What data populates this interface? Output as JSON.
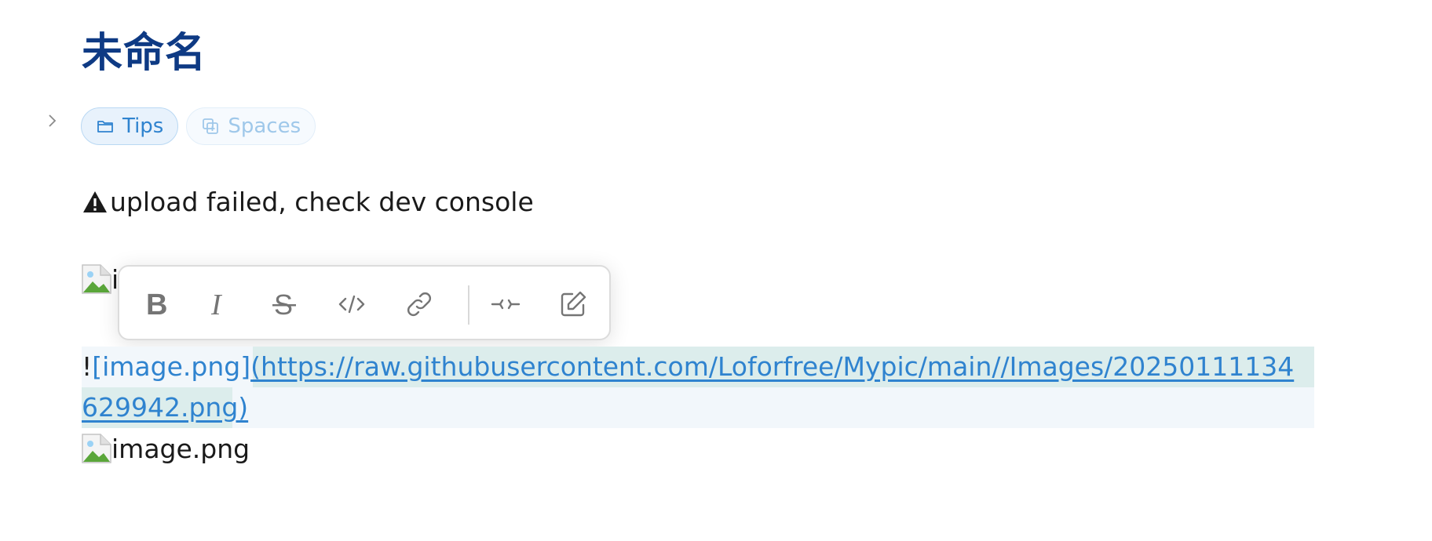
{
  "document": {
    "title": "未命名"
  },
  "tags": [
    {
      "label": "Tips",
      "icon": "folder-icon"
    },
    {
      "label": "Spaces",
      "icon": "spaces-icon"
    }
  ],
  "warning": {
    "icon": "warning-icon",
    "text": "upload failed, check dev console"
  },
  "broken_image_1": {
    "alt_visible": "i"
  },
  "toolbar": {
    "buttons": [
      {
        "name": "bold",
        "icon": "bold-icon"
      },
      {
        "name": "italic",
        "icon": "italic-icon"
      },
      {
        "name": "strikethrough",
        "icon": "strikethrough-icon"
      },
      {
        "name": "code",
        "icon": "code-icon"
      },
      {
        "name": "link",
        "icon": "link-icon"
      },
      {
        "name": "commit",
        "icon": "commit-icon"
      },
      {
        "name": "edit",
        "icon": "edit-icon"
      }
    ]
  },
  "markdown": {
    "bang": "!",
    "alt": "[image.png]",
    "url": "(https://raw.githubusercontent.com/Loforfree/Mypic/main//Images/20250111134629942.png)"
  },
  "broken_image_2": {
    "alt": "image.png"
  },
  "colors": {
    "title": "#0e3a84",
    "accent": "#2f83cf",
    "highlight": "#dcedec",
    "block_bg": "#f2f7fb"
  }
}
